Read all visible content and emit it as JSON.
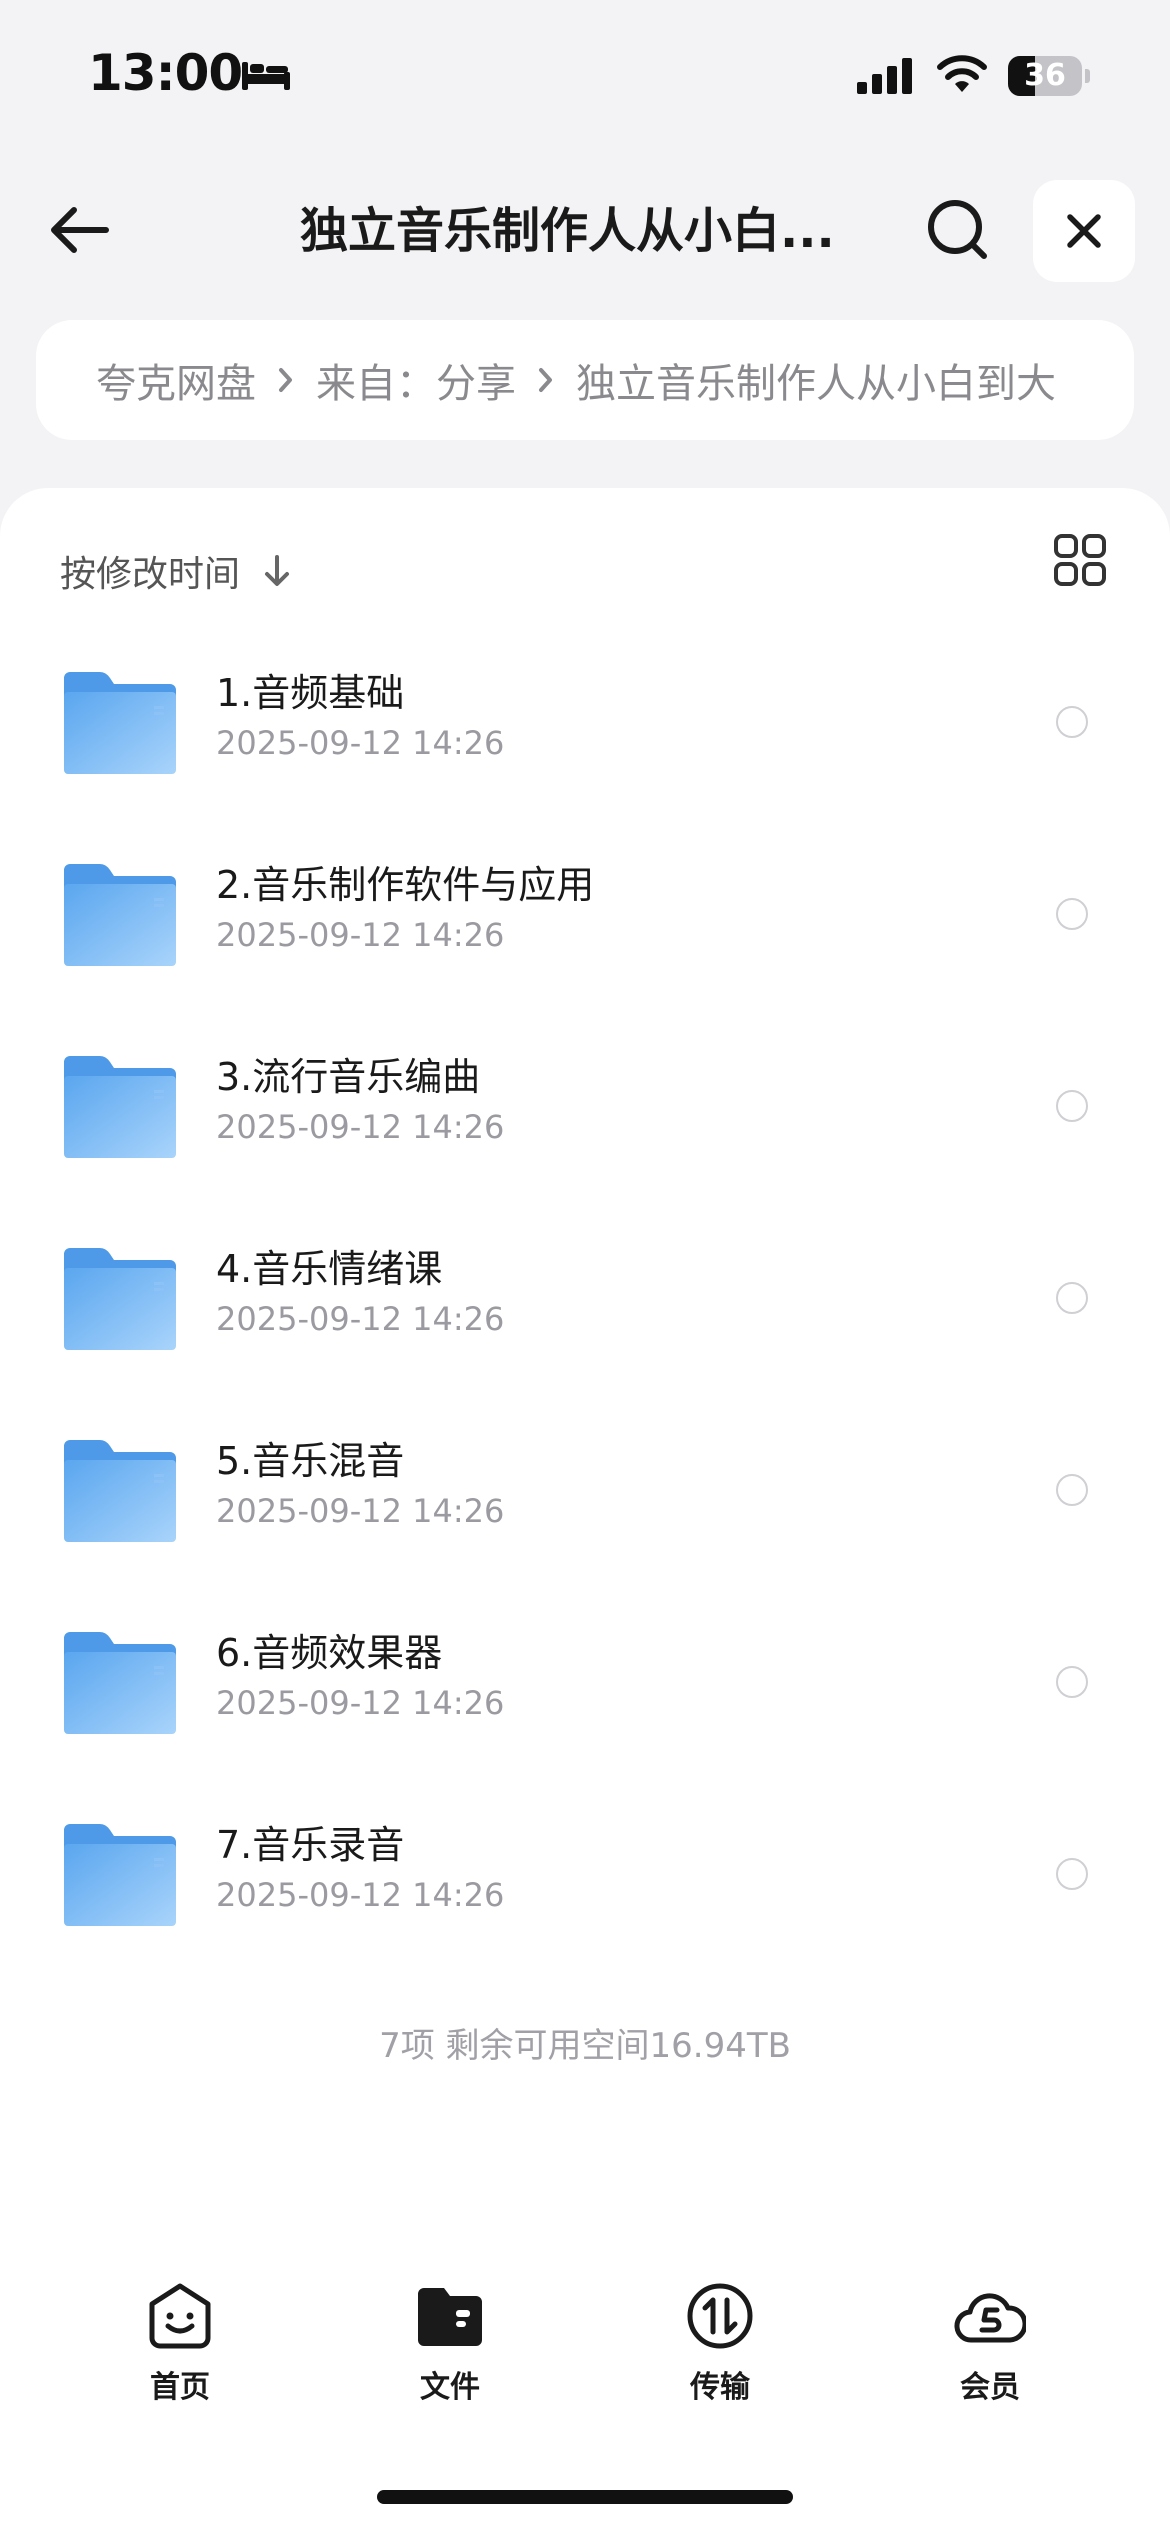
{
  "status_bar": {
    "time": "13:00",
    "battery_level": "36",
    "battery_percent": 36,
    "icons": [
      "bed-icon",
      "signal-icon",
      "wifi-icon",
      "battery-icon"
    ]
  },
  "nav": {
    "title": "独立音乐制作人从小白...",
    "back_icon": "arrow-left-icon",
    "search_icon": "search-icon",
    "close_icon": "close-icon"
  },
  "breadcrumb": {
    "items": [
      "夸克网盘",
      "来自：分享",
      "独立音乐制作人从小白到大"
    ]
  },
  "list": {
    "sort_label": "按修改时间",
    "sort_direction": "descending",
    "view_toggle_icon": "grid-view-icon",
    "files": [
      {
        "name": "1.音频基础",
        "date": "2025-09-12 14:26"
      },
      {
        "name": "2.音乐制作软件与应用",
        "date": "2025-09-12 14:26"
      },
      {
        "name": "3.流行音乐编曲",
        "date": "2025-09-12 14:26"
      },
      {
        "name": "4.音乐情绪课",
        "date": "2025-09-12 14:26"
      },
      {
        "name": "5.音乐混音",
        "date": "2025-09-12 14:26"
      },
      {
        "name": "6.音频效果器",
        "date": "2025-09-12 14:26"
      },
      {
        "name": "7.音乐录音",
        "date": "2025-09-12 14:26"
      }
    ],
    "summary": "7项 剩余可用空间16.94TB"
  },
  "tab_bar": {
    "active_tab": "文件",
    "tabs": [
      {
        "label": "首页",
        "icon": "home-face-icon"
      },
      {
        "label": "文件",
        "icon": "folder-tab-icon"
      },
      {
        "label": "传输",
        "icon": "transfer-icon"
      },
      {
        "label": "会员",
        "icon": "cloud-member-icon"
      }
    ]
  },
  "colors": {
    "background": "#f3f3f5",
    "folder_blue": "#5aa6ef",
    "text_primary": "#1a1a1a",
    "text_secondary": "#9a9aa0"
  }
}
